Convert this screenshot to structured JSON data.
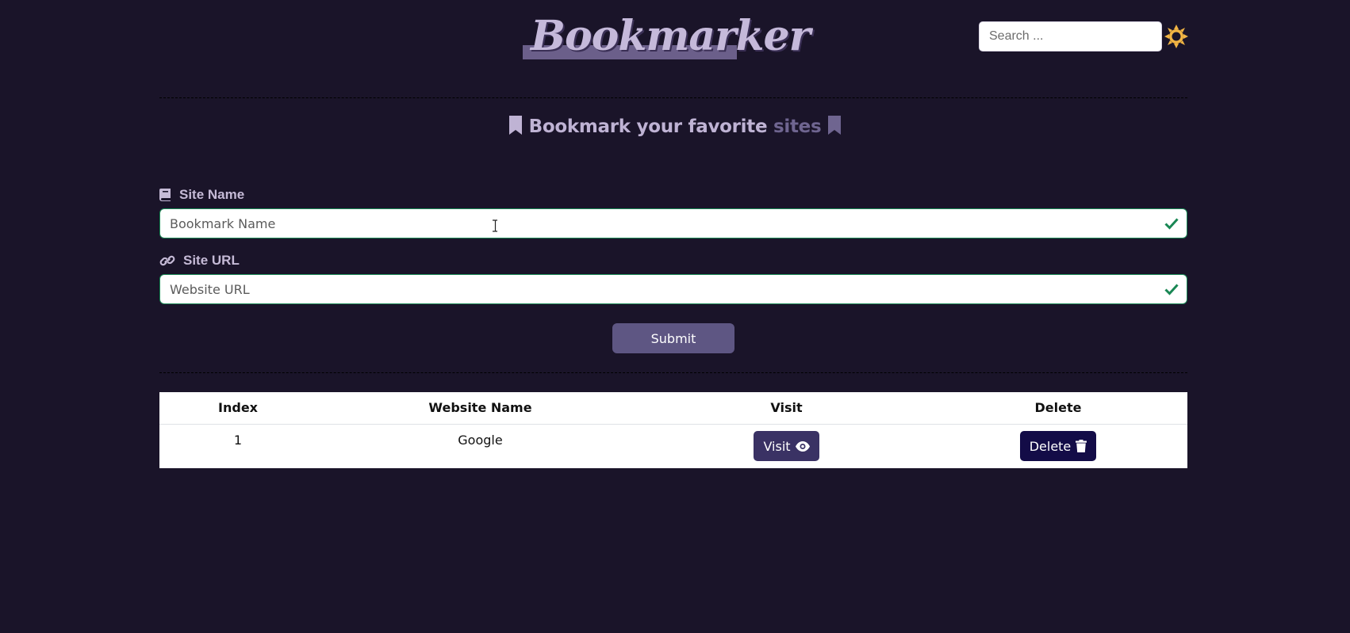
{
  "header": {
    "logo_text": "Bookmarker",
    "search_placeholder": "Search ..."
  },
  "headline": {
    "main": "Bookmark your favorite",
    "muted": "sites"
  },
  "form": {
    "site_name_label": "Site Name",
    "site_name_placeholder": "Bookmark Name",
    "site_url_label": "Site URL",
    "site_url_placeholder": "Website URL",
    "submit_label": "Submit"
  },
  "table": {
    "headers": [
      "Index",
      "Website Name",
      "Visit",
      "Delete"
    ],
    "rows": [
      {
        "index": "1",
        "name": "Google",
        "visit_label": "Visit",
        "delete_label": "Delete"
      }
    ]
  },
  "colors": {
    "background": "#1a1429",
    "valid_green": "#198754",
    "sun": "#f2b544"
  }
}
